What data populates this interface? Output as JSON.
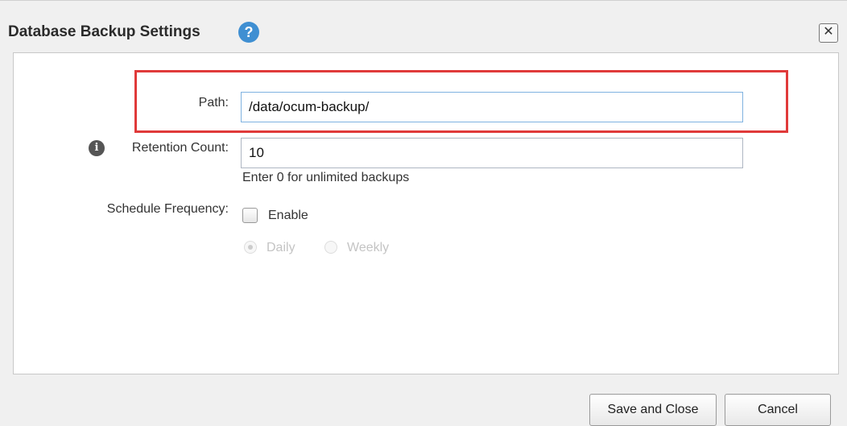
{
  "dialog": {
    "title": "Database Backup Settings",
    "help_icon": "question-mark-icon",
    "close_icon": "close-x-icon"
  },
  "form": {
    "path": {
      "label": "Path:",
      "value": "/data/ocum-backup/"
    },
    "retention": {
      "label": "Retention Count:",
      "icon": "info-icon",
      "value": "10",
      "hint": "Enter 0 for unlimited backups"
    },
    "schedule": {
      "label": "Schedule Frequency:",
      "enable_label": "Enable",
      "enable_checked": false,
      "daily_label": "Daily",
      "weekly_label": "Weekly",
      "selected": "Daily"
    }
  },
  "buttons": {
    "save_label": "Save and Close",
    "cancel_label": "Cancel"
  },
  "colors": {
    "highlight": "#e03a3a",
    "help_icon": "#3f8fd2"
  }
}
